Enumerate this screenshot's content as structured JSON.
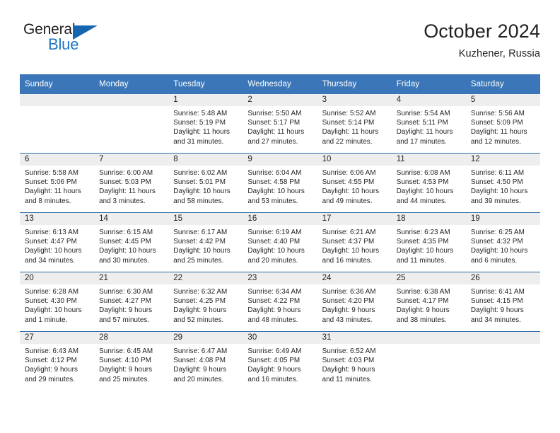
{
  "brand": {
    "name_top": "General",
    "name_bottom": "Blue",
    "accent_color": "#1e76c4",
    "triangle_color": "#1565b0"
  },
  "header": {
    "title": "October 2024",
    "subtitle": "Kuzhener, Russia"
  },
  "theme": {
    "header_row_bg": "#3b77b8",
    "header_row_text": "#ffffff",
    "row_divider": "#2e6da8",
    "daynum_bg": "#eeeeee",
    "text": "#231f20"
  },
  "weekday_headers": [
    "Sunday",
    "Monday",
    "Tuesday",
    "Wednesday",
    "Thursday",
    "Friday",
    "Saturday"
  ],
  "weeks": [
    [
      {
        "day": "",
        "sunrise": "",
        "sunset": "",
        "daylight1": "",
        "daylight2": ""
      },
      {
        "day": "",
        "sunrise": "",
        "sunset": "",
        "daylight1": "",
        "daylight2": ""
      },
      {
        "day": "1",
        "sunrise": "Sunrise: 5:48 AM",
        "sunset": "Sunset: 5:19 PM",
        "daylight1": "Daylight: 11 hours",
        "daylight2": "and 31 minutes."
      },
      {
        "day": "2",
        "sunrise": "Sunrise: 5:50 AM",
        "sunset": "Sunset: 5:17 PM",
        "daylight1": "Daylight: 11 hours",
        "daylight2": "and 27 minutes."
      },
      {
        "day": "3",
        "sunrise": "Sunrise: 5:52 AM",
        "sunset": "Sunset: 5:14 PM",
        "daylight1": "Daylight: 11 hours",
        "daylight2": "and 22 minutes."
      },
      {
        "day": "4",
        "sunrise": "Sunrise: 5:54 AM",
        "sunset": "Sunset: 5:11 PM",
        "daylight1": "Daylight: 11 hours",
        "daylight2": "and 17 minutes."
      },
      {
        "day": "5",
        "sunrise": "Sunrise: 5:56 AM",
        "sunset": "Sunset: 5:09 PM",
        "daylight1": "Daylight: 11 hours",
        "daylight2": "and 12 minutes."
      }
    ],
    [
      {
        "day": "6",
        "sunrise": "Sunrise: 5:58 AM",
        "sunset": "Sunset: 5:06 PM",
        "daylight1": "Daylight: 11 hours",
        "daylight2": "and 8 minutes."
      },
      {
        "day": "7",
        "sunrise": "Sunrise: 6:00 AM",
        "sunset": "Sunset: 5:03 PM",
        "daylight1": "Daylight: 11 hours",
        "daylight2": "and 3 minutes."
      },
      {
        "day": "8",
        "sunrise": "Sunrise: 6:02 AM",
        "sunset": "Sunset: 5:01 PM",
        "daylight1": "Daylight: 10 hours",
        "daylight2": "and 58 minutes."
      },
      {
        "day": "9",
        "sunrise": "Sunrise: 6:04 AM",
        "sunset": "Sunset: 4:58 PM",
        "daylight1": "Daylight: 10 hours",
        "daylight2": "and 53 minutes."
      },
      {
        "day": "10",
        "sunrise": "Sunrise: 6:06 AM",
        "sunset": "Sunset: 4:55 PM",
        "daylight1": "Daylight: 10 hours",
        "daylight2": "and 49 minutes."
      },
      {
        "day": "11",
        "sunrise": "Sunrise: 6:08 AM",
        "sunset": "Sunset: 4:53 PM",
        "daylight1": "Daylight: 10 hours",
        "daylight2": "and 44 minutes."
      },
      {
        "day": "12",
        "sunrise": "Sunrise: 6:11 AM",
        "sunset": "Sunset: 4:50 PM",
        "daylight1": "Daylight: 10 hours",
        "daylight2": "and 39 minutes."
      }
    ],
    [
      {
        "day": "13",
        "sunrise": "Sunrise: 6:13 AM",
        "sunset": "Sunset: 4:47 PM",
        "daylight1": "Daylight: 10 hours",
        "daylight2": "and 34 minutes."
      },
      {
        "day": "14",
        "sunrise": "Sunrise: 6:15 AM",
        "sunset": "Sunset: 4:45 PM",
        "daylight1": "Daylight: 10 hours",
        "daylight2": "and 30 minutes."
      },
      {
        "day": "15",
        "sunrise": "Sunrise: 6:17 AM",
        "sunset": "Sunset: 4:42 PM",
        "daylight1": "Daylight: 10 hours",
        "daylight2": "and 25 minutes."
      },
      {
        "day": "16",
        "sunrise": "Sunrise: 6:19 AM",
        "sunset": "Sunset: 4:40 PM",
        "daylight1": "Daylight: 10 hours",
        "daylight2": "and 20 minutes."
      },
      {
        "day": "17",
        "sunrise": "Sunrise: 6:21 AM",
        "sunset": "Sunset: 4:37 PM",
        "daylight1": "Daylight: 10 hours",
        "daylight2": "and 16 minutes."
      },
      {
        "day": "18",
        "sunrise": "Sunrise: 6:23 AM",
        "sunset": "Sunset: 4:35 PM",
        "daylight1": "Daylight: 10 hours",
        "daylight2": "and 11 minutes."
      },
      {
        "day": "19",
        "sunrise": "Sunrise: 6:25 AM",
        "sunset": "Sunset: 4:32 PM",
        "daylight1": "Daylight: 10 hours",
        "daylight2": "and 6 minutes."
      }
    ],
    [
      {
        "day": "20",
        "sunrise": "Sunrise: 6:28 AM",
        "sunset": "Sunset: 4:30 PM",
        "daylight1": "Daylight: 10 hours",
        "daylight2": "and 1 minute."
      },
      {
        "day": "21",
        "sunrise": "Sunrise: 6:30 AM",
        "sunset": "Sunset: 4:27 PM",
        "daylight1": "Daylight: 9 hours",
        "daylight2": "and 57 minutes."
      },
      {
        "day": "22",
        "sunrise": "Sunrise: 6:32 AM",
        "sunset": "Sunset: 4:25 PM",
        "daylight1": "Daylight: 9 hours",
        "daylight2": "and 52 minutes."
      },
      {
        "day": "23",
        "sunrise": "Sunrise: 6:34 AM",
        "sunset": "Sunset: 4:22 PM",
        "daylight1": "Daylight: 9 hours",
        "daylight2": "and 48 minutes."
      },
      {
        "day": "24",
        "sunrise": "Sunrise: 6:36 AM",
        "sunset": "Sunset: 4:20 PM",
        "daylight1": "Daylight: 9 hours",
        "daylight2": "and 43 minutes."
      },
      {
        "day": "25",
        "sunrise": "Sunrise: 6:38 AM",
        "sunset": "Sunset: 4:17 PM",
        "daylight1": "Daylight: 9 hours",
        "daylight2": "and 38 minutes."
      },
      {
        "day": "26",
        "sunrise": "Sunrise: 6:41 AM",
        "sunset": "Sunset: 4:15 PM",
        "daylight1": "Daylight: 9 hours",
        "daylight2": "and 34 minutes."
      }
    ],
    [
      {
        "day": "27",
        "sunrise": "Sunrise: 6:43 AM",
        "sunset": "Sunset: 4:12 PM",
        "daylight1": "Daylight: 9 hours",
        "daylight2": "and 29 minutes."
      },
      {
        "day": "28",
        "sunrise": "Sunrise: 6:45 AM",
        "sunset": "Sunset: 4:10 PM",
        "daylight1": "Daylight: 9 hours",
        "daylight2": "and 25 minutes."
      },
      {
        "day": "29",
        "sunrise": "Sunrise: 6:47 AM",
        "sunset": "Sunset: 4:08 PM",
        "daylight1": "Daylight: 9 hours",
        "daylight2": "and 20 minutes."
      },
      {
        "day": "30",
        "sunrise": "Sunrise: 6:49 AM",
        "sunset": "Sunset: 4:05 PM",
        "daylight1": "Daylight: 9 hours",
        "daylight2": "and 16 minutes."
      },
      {
        "day": "31",
        "sunrise": "Sunrise: 6:52 AM",
        "sunset": "Sunset: 4:03 PM",
        "daylight1": "Daylight: 9 hours",
        "daylight2": "and 11 minutes."
      },
      {
        "day": "",
        "sunrise": "",
        "sunset": "",
        "daylight1": "",
        "daylight2": ""
      },
      {
        "day": "",
        "sunrise": "",
        "sunset": "",
        "daylight1": "",
        "daylight2": ""
      }
    ]
  ]
}
